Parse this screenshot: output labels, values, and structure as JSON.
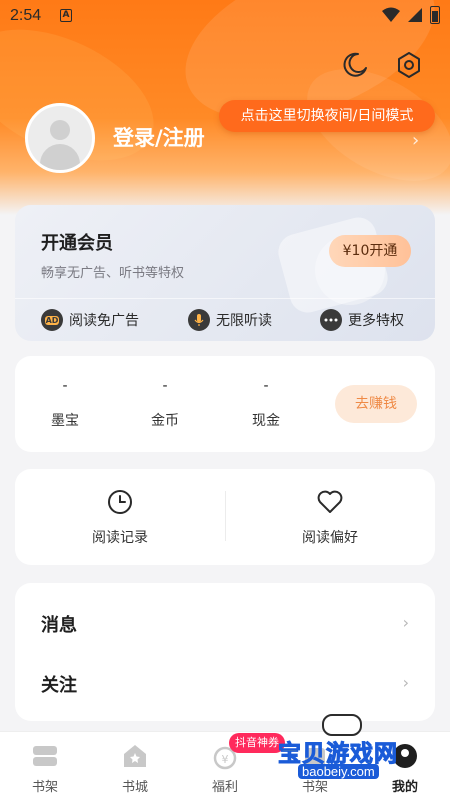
{
  "statusbar": {
    "time": "2:54",
    "notif_icon": "A"
  },
  "header": {
    "login_label": "登录/注册",
    "tooltip": "点击这里切换夜间/日间模式",
    "login_chevron": "›"
  },
  "vip": {
    "title": "开通会员",
    "subtitle": "畅享无广告、听书等特权",
    "buy_label": "¥10开通",
    "perks": [
      {
        "label": "阅读免广告",
        "icon": "ad-icon",
        "icon_text": "AD"
      },
      {
        "label": "无限听读",
        "icon": "microphone-icon"
      },
      {
        "label": "更多特权",
        "icon": "more-icon"
      }
    ]
  },
  "wallet": {
    "items": [
      {
        "value": "-",
        "label": "墨宝"
      },
      {
        "value": "-",
        "label": "金币"
      },
      {
        "value": "-",
        "label": "现金"
      }
    ],
    "earn_label": "去赚钱"
  },
  "reading": {
    "history_label": "阅读记录",
    "preference_label": "阅读偏好"
  },
  "menu": {
    "items": [
      {
        "label": "消息",
        "chevron": "›"
      },
      {
        "label": "关注",
        "chevron": "›"
      }
    ]
  },
  "tabbar": {
    "tabs": [
      {
        "label": "书架",
        "icon": "bookshelf-icon"
      },
      {
        "label": "书城",
        "icon": "store-icon"
      },
      {
        "label": "福利",
        "icon": "bonus-icon"
      },
      {
        "label": "书架",
        "icon": "shelf-icon"
      },
      {
        "label": "我的",
        "icon": "profile-icon"
      }
    ],
    "promo_badge": "抖音神券",
    "active_color": "#1f1f1f"
  },
  "watermark": {
    "brand": "宝贝游戏网",
    "url": "baobeiy.com"
  },
  "colors": {
    "accent": "#ff7a16",
    "tooltip_bg": "#ff6a1c",
    "promo_bg": "#ff2a5c",
    "earn_text": "#ef8a46"
  }
}
